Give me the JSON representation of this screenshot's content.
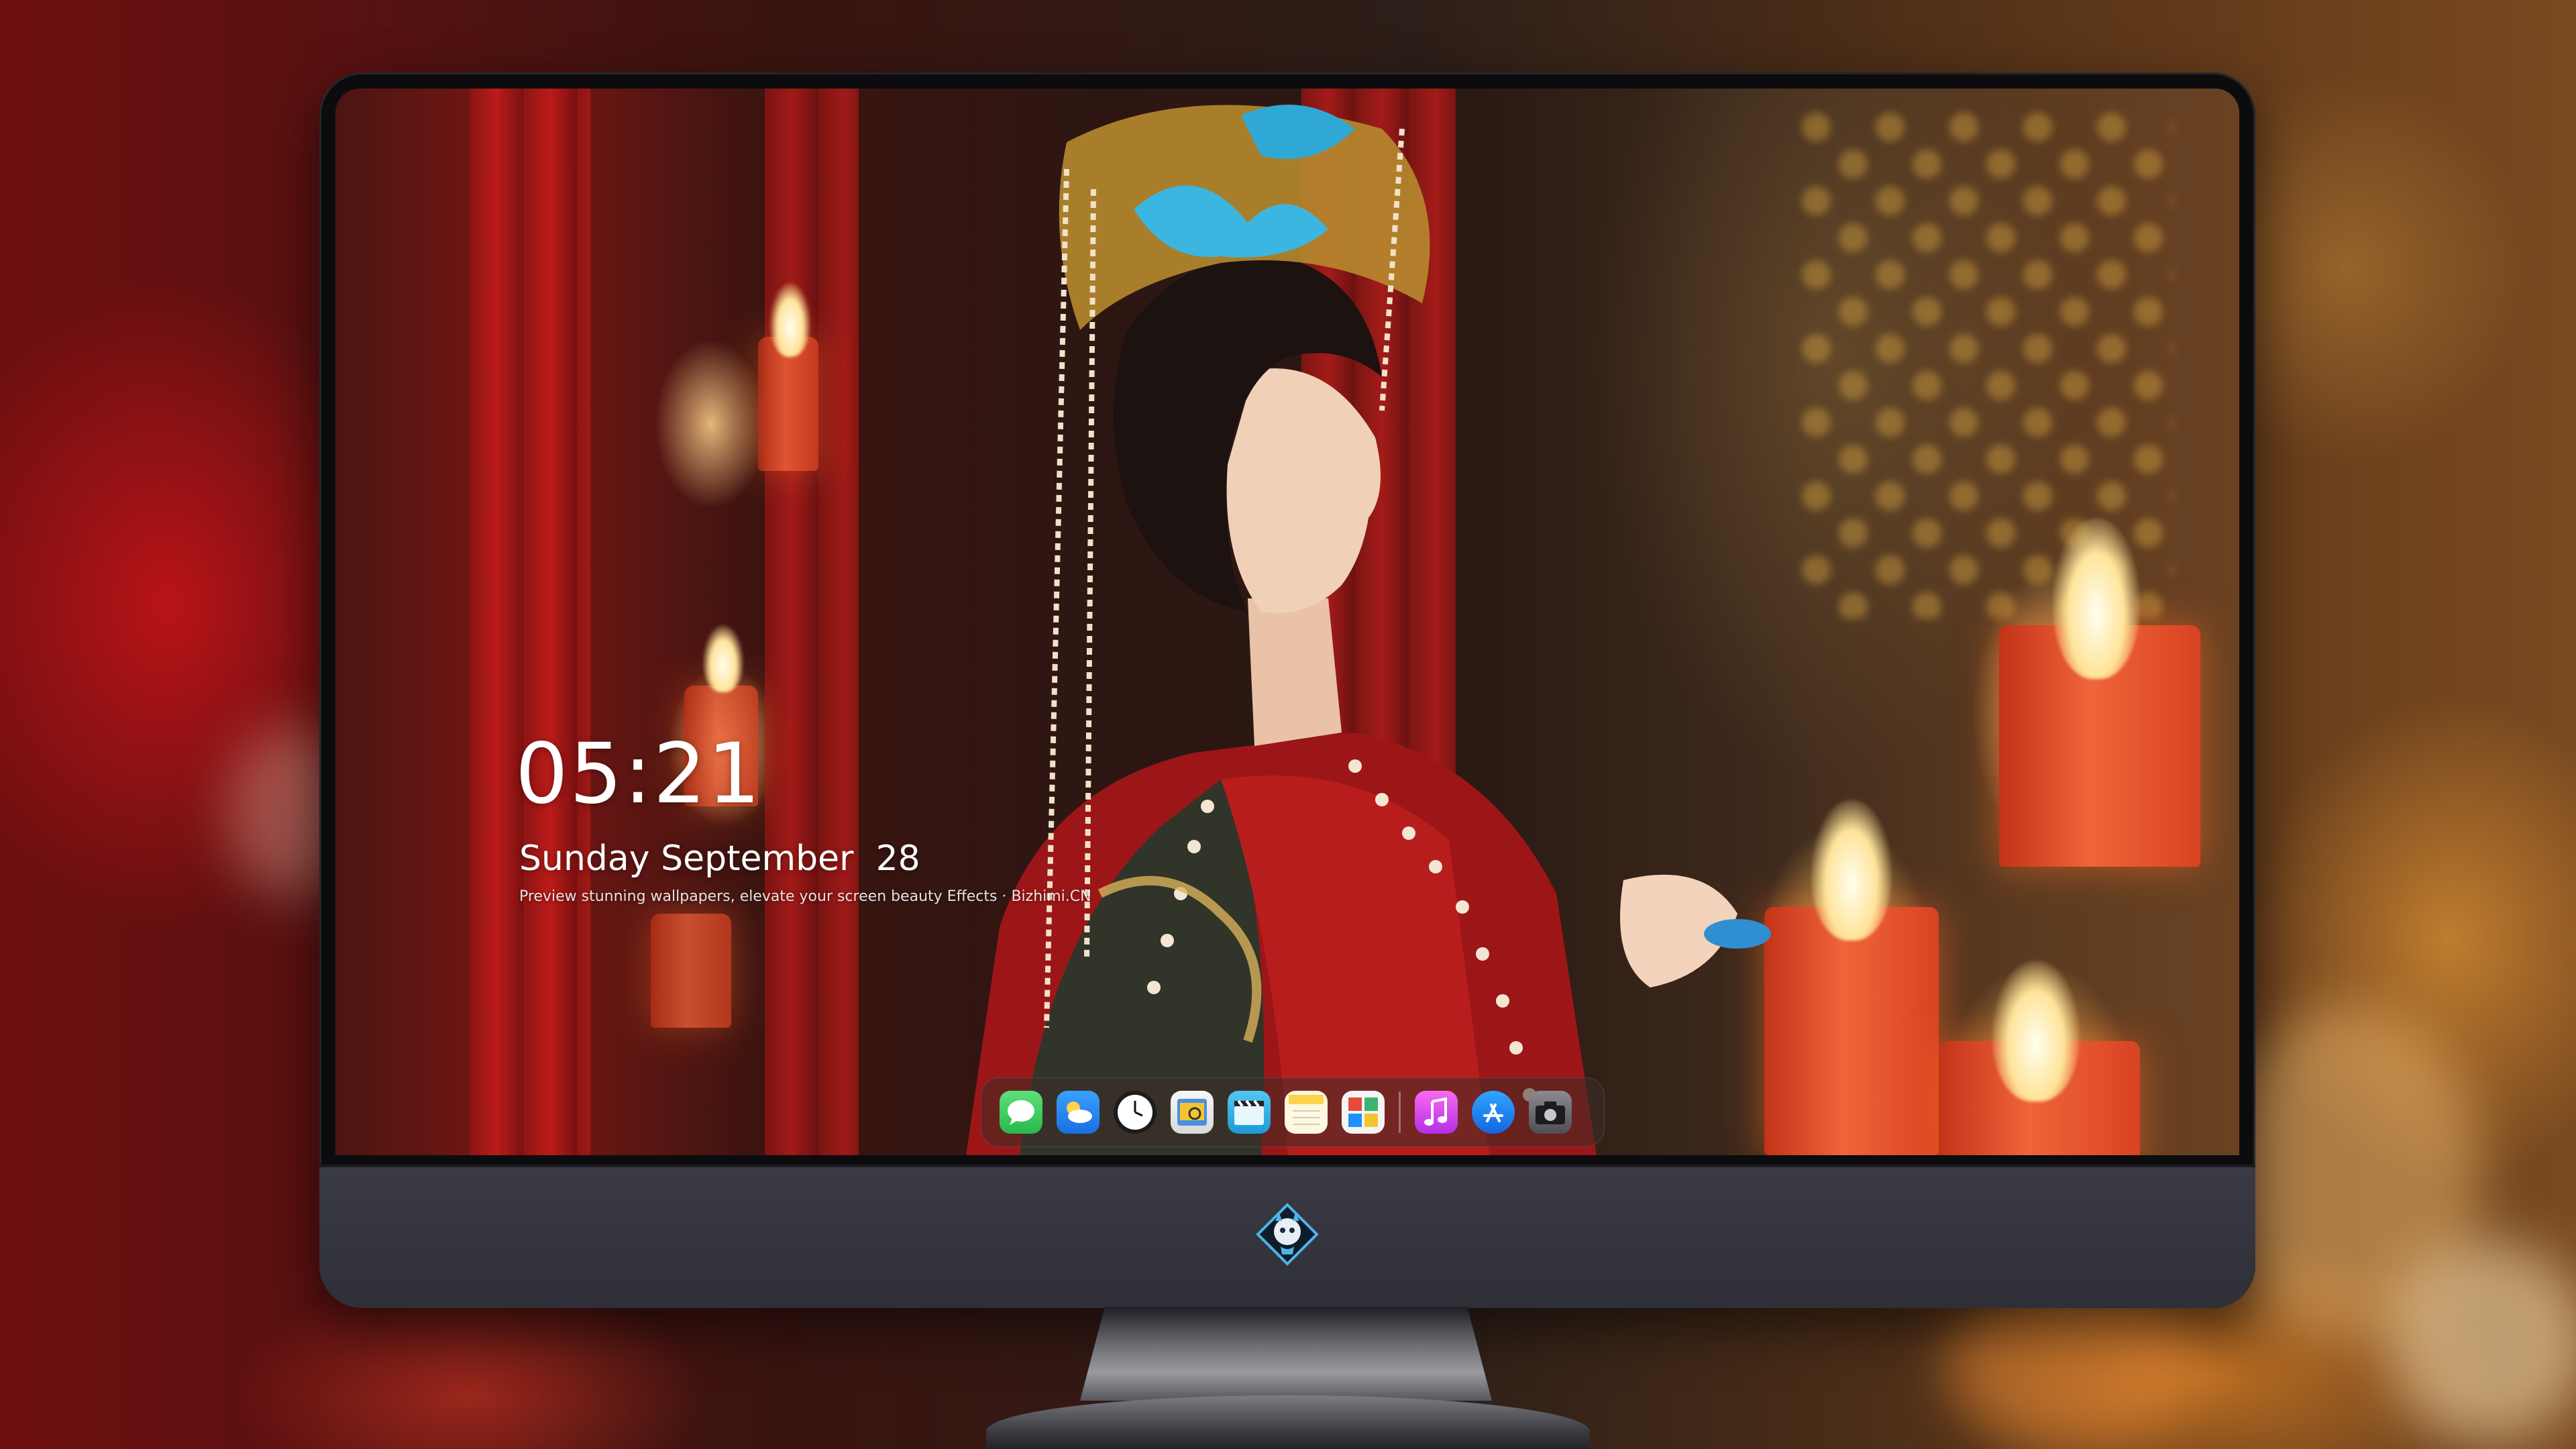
{
  "lock_screen": {
    "time": "05:21",
    "date": "Sunday September  28",
    "tagline": "Preview stunning wallpapers, elevate your screen beauty  Effects · Bizhimi.CN"
  },
  "dock": {
    "apps": [
      {
        "name": "messages-icon",
        "color": "#34c759"
      },
      {
        "name": "weather-icon",
        "color": "#1e90ff"
      },
      {
        "name": "clock-icon",
        "color": "#ffffff"
      },
      {
        "name": "preview-icon",
        "color": "#f4c430"
      },
      {
        "name": "clips-icon",
        "color": "#2fb6e8"
      },
      {
        "name": "notes-icon",
        "color": "#ffd34d"
      },
      {
        "name": "photo-booth-icon",
        "color": "#e64a3c"
      },
      {
        "name": "music-icon",
        "color": "#c13cf0"
      },
      {
        "name": "app-store-icon",
        "color": "#1a8cff"
      },
      {
        "name": "camera-icon",
        "color": "#6d6d72"
      }
    ]
  },
  "monitor": {
    "logo": "dragon-mascot-icon"
  }
}
